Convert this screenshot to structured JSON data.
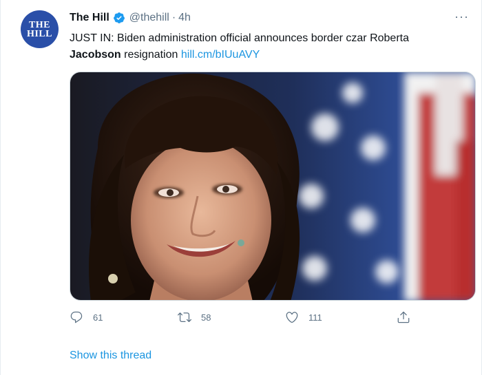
{
  "tweet": {
    "author_name": "The Hill",
    "handle": "@thehill",
    "separator": "·",
    "time": "4h",
    "avatar_text_line1": "THE",
    "avatar_text_line2": "HILL",
    "text_part1": "JUST IN: Biden administration official announces border czar Roberta",
    "text_bold": "Jacobson",
    "text_part2": " resignation ",
    "link": "hill.cm/bIUuAVY",
    "more_label": "···"
  },
  "actions": {
    "reply_count": "61",
    "retweet_count": "58",
    "like_count": "111"
  },
  "thread": {
    "show_label": "Show this thread"
  },
  "colors": {
    "accent": "#1b95e0",
    "avatar_bg": "#2a4fa8",
    "muted": "#5b7083"
  },
  "icons": {
    "verified": "verified-badge-icon",
    "reply": "reply-icon",
    "retweet": "retweet-icon",
    "like": "heart-icon",
    "share": "share-icon",
    "more": "more-dots-icon"
  }
}
